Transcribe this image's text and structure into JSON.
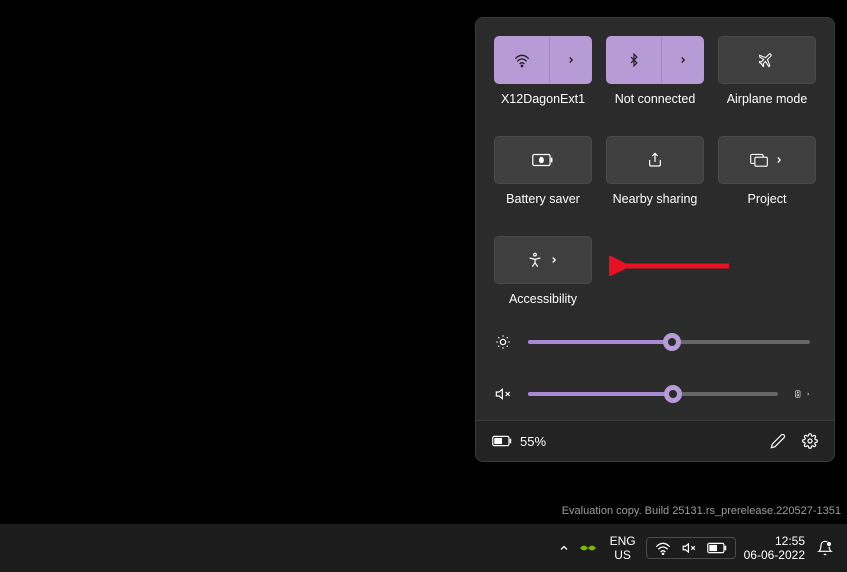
{
  "tiles": [
    {
      "id": "wifi",
      "label": "X12DagonExt1",
      "active": true,
      "split": true,
      "icon": "wifi"
    },
    {
      "id": "bluetooth",
      "label": "Not connected",
      "active": true,
      "split": true,
      "icon": "bluetooth"
    },
    {
      "id": "airplane",
      "label": "Airplane mode",
      "active": false,
      "split": false,
      "icon": "airplane"
    },
    {
      "id": "battery-saver",
      "label": "Battery saver",
      "active": false,
      "split": false,
      "icon": "battery-saver"
    },
    {
      "id": "nearby",
      "label": "Nearby sharing",
      "active": false,
      "split": false,
      "icon": "share"
    },
    {
      "id": "project",
      "label": "Project",
      "active": false,
      "split": false,
      "icon": "project",
      "chev": true
    },
    {
      "id": "accessibility",
      "label": "Accessibility",
      "active": false,
      "split": false,
      "icon": "accessibility",
      "chev": true
    }
  ],
  "sliders": {
    "brightness": {
      "value": 51
    },
    "volume": {
      "value": 58,
      "muted": true,
      "flyout": true
    }
  },
  "footer": {
    "battery_pct": "55%"
  },
  "watermark": "Evaluation copy. Build 25131.rs_prerelease.220527-1351",
  "taskbar": {
    "lang_top": "ENG",
    "lang_bottom": "US",
    "time": "12:55",
    "date": "06-06-2022"
  }
}
